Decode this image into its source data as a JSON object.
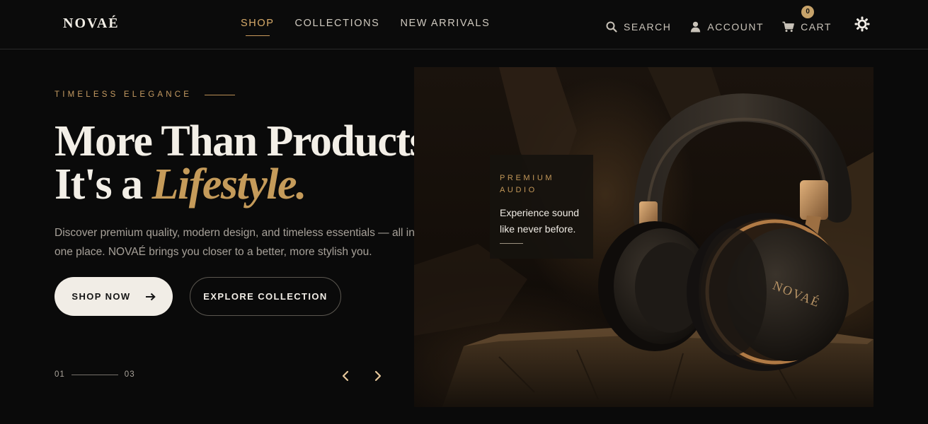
{
  "brand": {
    "logo": "NOVAÉ"
  },
  "nav": {
    "items": [
      {
        "label": "SHOP",
        "active": true
      },
      {
        "label": "COLLECTIONS",
        "active": false
      },
      {
        "label": "NEW ARRIVALS",
        "active": false
      }
    ]
  },
  "tools": {
    "search_label": "SEARCH",
    "account_label": "ACCOUNT",
    "cart_label": "CART",
    "cart_count": "0",
    "icons": [
      "search-icon",
      "user-icon",
      "cart-icon",
      "sun-icon"
    ]
  },
  "hero": {
    "eyebrow": "TIMELESS ELEGANCE",
    "headline_line1": "More Than Products,",
    "headline_line2_prefix": "It's a ",
    "headline_line2_accent": "Lifestyle.",
    "description": "Discover premium quality, modern design, and timeless essentials — all in one place. NOVAÉ brings you closer to a better, more stylish you.",
    "primary_button": "SHOP NOW",
    "secondary_button": "EXPLORE COLLECTION",
    "slide_current": "01",
    "slide_total": "03"
  },
  "promo": {
    "tag": "PREMIUM AUDIO",
    "text": "Experience sound like never before.",
    "product_brand": "NOVAÉ"
  },
  "colors": {
    "background": "#0a0a0a",
    "accent_gold": "#c59b5a",
    "text_light": "#f3efe7",
    "text_muted": "#a7a199",
    "button_light": "#f1ede6"
  }
}
